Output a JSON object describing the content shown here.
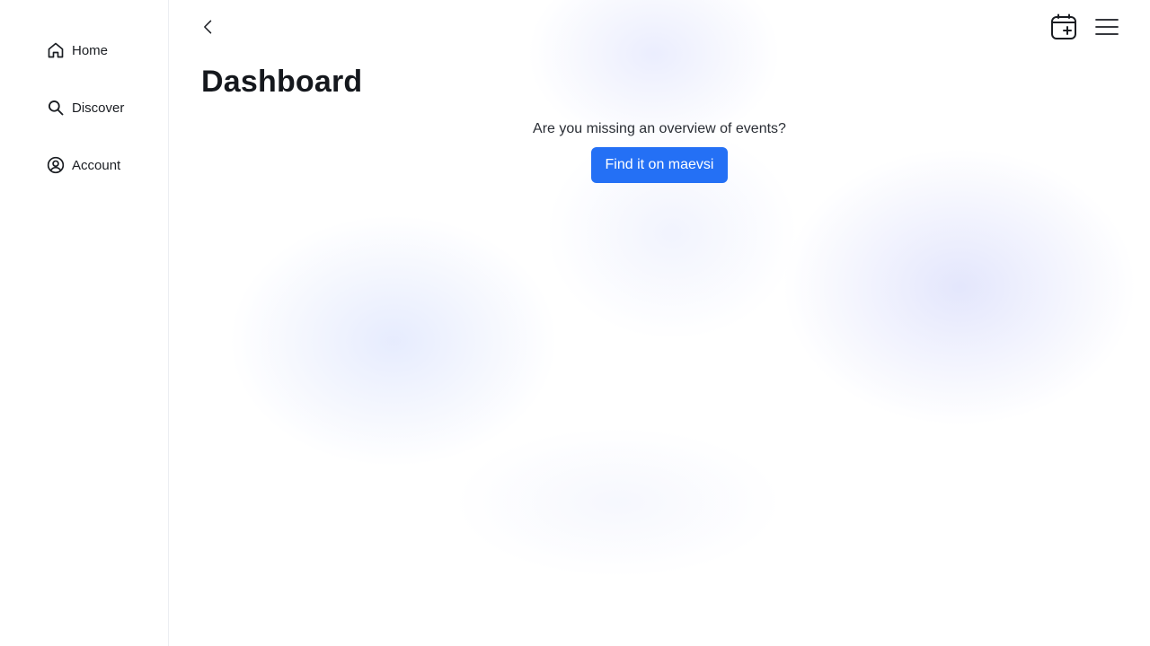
{
  "sidebar": {
    "items": [
      {
        "label": "Home",
        "icon": "home-icon"
      },
      {
        "label": "Discover",
        "icon": "search-icon"
      },
      {
        "label": "Account",
        "icon": "account-icon"
      }
    ]
  },
  "header": {
    "title": "Dashboard",
    "back_icon": "chevron-left-icon",
    "calendar_icon": "calendar-plus-icon",
    "menu_icon": "hamburger-menu-icon"
  },
  "main": {
    "prompt_text": "Are you missing an overview of events?",
    "cta_label": "Find it on maevsi"
  },
  "colors": {
    "accent": "#2470f5",
    "text": "#15181d",
    "background": "#ffffff"
  }
}
